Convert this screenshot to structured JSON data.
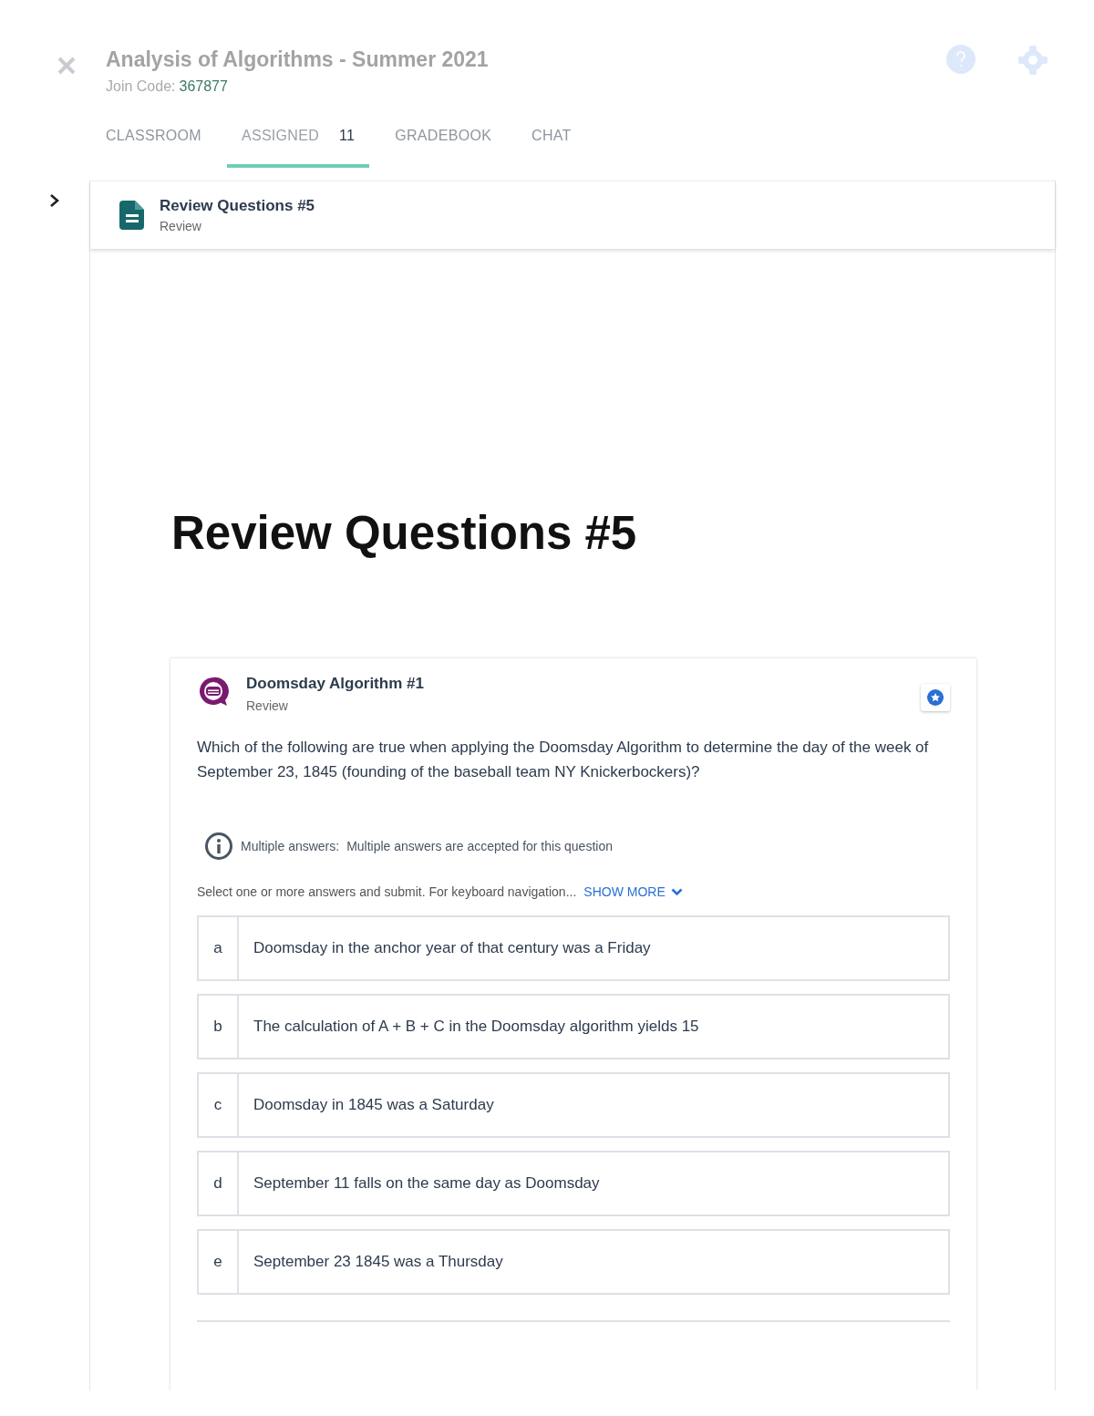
{
  "course": {
    "title": "Analysis of Algorithms - Summer 2021",
    "join_code_label": "Join Code:",
    "join_code": "367877"
  },
  "tabs": [
    {
      "label": "CLASSROOM",
      "selected": false
    },
    {
      "label": "ASSIGNED",
      "count": "11",
      "selected": true
    },
    {
      "label": "GRADEBOOK",
      "selected": false
    },
    {
      "label": "CHAT",
      "selected": false
    }
  ],
  "assignment": {
    "title": "Review Questions #5",
    "type": "Review"
  },
  "page_title": "Review Questions #5",
  "question": {
    "title": "Doomsday Algorithm #1",
    "type": "Review",
    "prompt": "Which of the following are true when applying the Doomsday Algorithm to determine the day of the week of September 23, 1845 (founding of the baseball team NY Knickerbockers)?",
    "info_label": "Multiple answers:",
    "info_text": "Multiple answers are accepted for this question",
    "instructions": "Select one or more answers and submit. For keyboard navigation...",
    "show_more": "SHOW MORE",
    "options": [
      {
        "letter": "a",
        "text": "Doomsday in the anchor year of that century was a Friday",
        "selected": false
      },
      {
        "letter": "b",
        "text": "The calculation of A + B + C in the Doomsday algorithm yields 15",
        "selected": false
      },
      {
        "letter": "c",
        "text": "Doomsday in 1845 was a Saturday",
        "selected": false
      },
      {
        "letter": "d",
        "text": "September 11 falls on the same day as Doomsday",
        "selected": false
      },
      {
        "letter": "e",
        "text": "September 23 1845 was a Thursday",
        "selected": false
      }
    ]
  }
}
